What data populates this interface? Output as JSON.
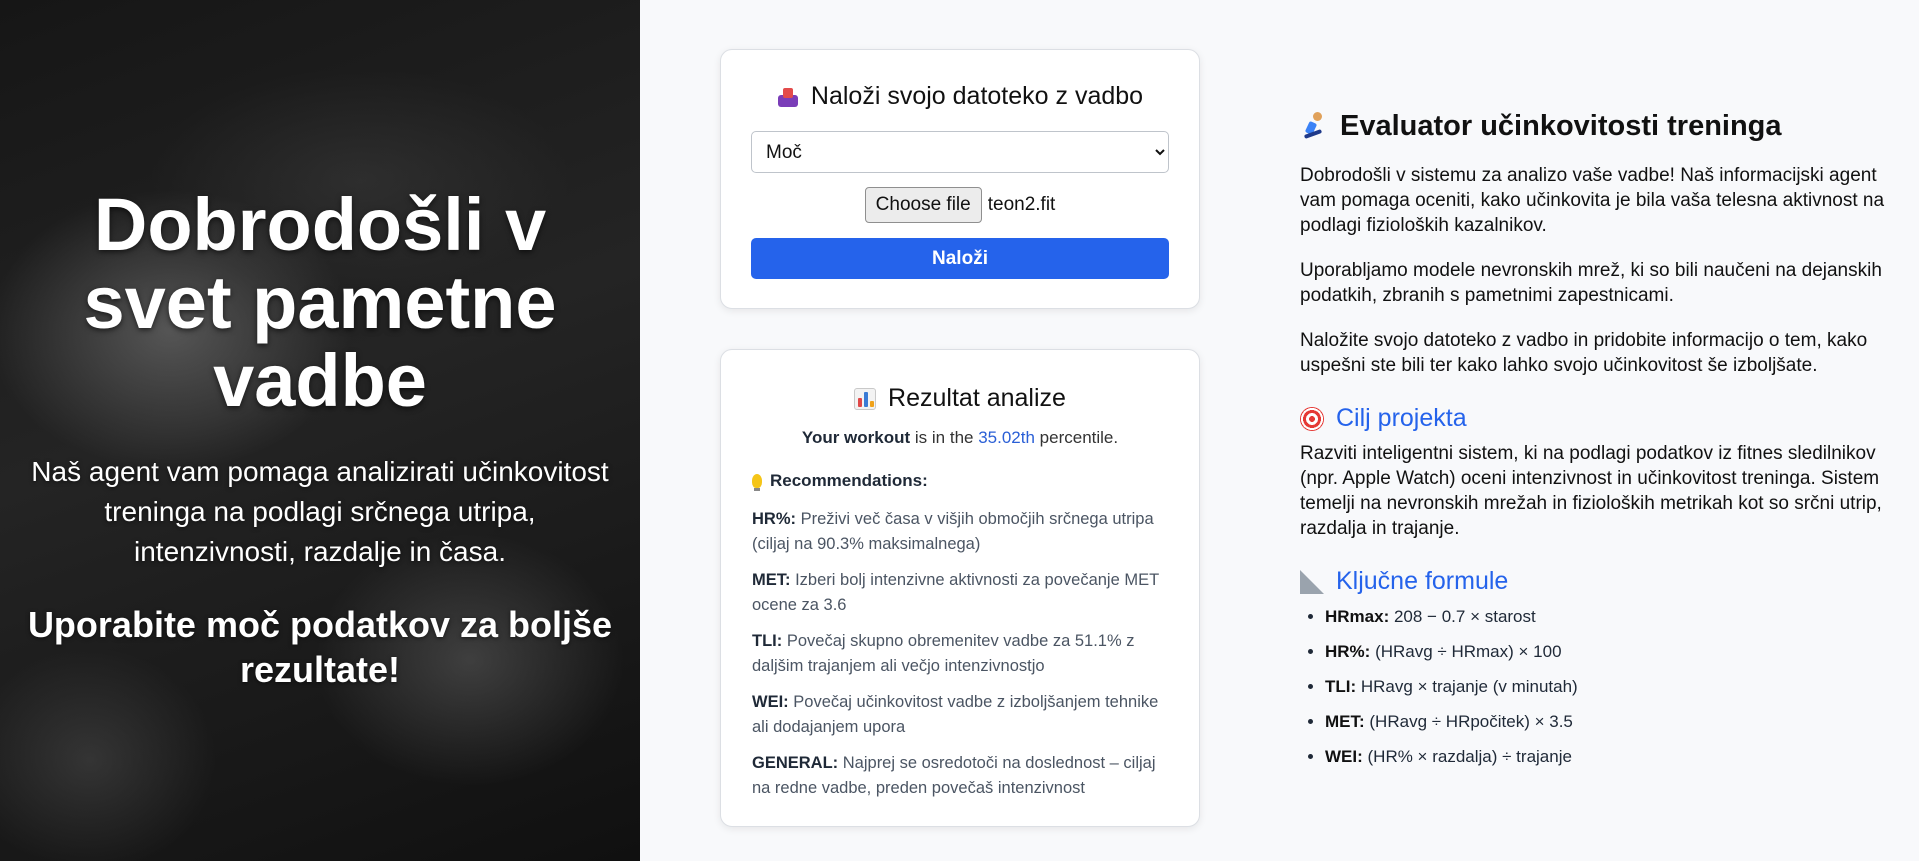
{
  "hero": {
    "title": "Dobrodošli v svet pametne vadbe",
    "lead": "Naš agent vam pomaga analizirati učinkovitost treninga na podlagi srčnega utripa, intenzivnosti, razdalje in časa.",
    "cta": "Uporabite moč podatkov za boljše rezultate!"
  },
  "upload": {
    "icon": "inbox-tray-icon",
    "title": "Naloži svojo datoteko z vadbo",
    "selected_option": "Moč",
    "choose_file_label": "Choose file",
    "file_name": "teon2.fit",
    "submit_label": "Naloži"
  },
  "result": {
    "icon": "bar-chart-icon",
    "title": "Rezultat analize",
    "workout_label": "Your workout",
    "mid_text": " is in the ",
    "percentile_value": "35.02th",
    "percentile_suffix": " percentile.",
    "recommendations_label": "Recommendations:",
    "recommendations": [
      {
        "key": "HR%:",
        "text": " Preživi več časa v višjih območjih srčnega utripa (ciljaj na 90.3% maksimalnega)"
      },
      {
        "key": "MET:",
        "text": " Izberi bolj intenzivne aktivnosti za povečanje MET ocene za 3.6"
      },
      {
        "key": "TLI:",
        "text": " Povečaj skupno obremenitev vadbe za 51.1% z daljšim trajanjem ali večjo intenzivnostjo"
      },
      {
        "key": "WEI:",
        "text": " Povečaj učinkovitost vadbe z izboljšanjem tehnike ali dodajanjem upora"
      },
      {
        "key": "GENERAL:",
        "text": " Najprej se osredotoči na doslednost – ciljaj na redne vadbe, preden povečaš intenzivnost"
      }
    ]
  },
  "info": {
    "title": "Evaluator učinkovitosti treninga",
    "p1": "Dobrodošli v sistemu za analizo vaše vadbe! Naš informacijski agent vam pomaga oceniti, kako učinkovita je bila vaša telesna aktivnost na podlagi fizioloških kazalnikov.",
    "p2": "Uporabljamo modele nevronskih mrež, ki so bili naučeni na dejanskih podatkih, zbranih s pametnimi zapestnicami.",
    "p3": "Naložite svojo datoteko z vadbo in pridobite informacijo o tem, kako uspešni ste bili ter kako lahko svojo učinkovitost še izboljšate.",
    "goal_title": "Cilj projekta",
    "goal_text": "Razviti inteligentni sistem, ki na podlagi podatkov iz fitnes sledilnikov (npr. Apple Watch) oceni intenzivnost in učinkovitost treninga. Sistem temelji na nevronskih mrežah in fizioloških metrikah kot so srčni utrip, razdalja in trajanje.",
    "formulas_title": "Ključne formule",
    "formulas": [
      {
        "key": "HRmax:",
        "text": " 208 − 0.7 × starost"
      },
      {
        "key": "HR%:",
        "text": " (HRavg ÷ HRmax) × 100"
      },
      {
        "key": "TLI:",
        "text": " HRavg × trajanje (v minutah)"
      },
      {
        "key": "MET:",
        "text": " (HRavg ÷ HRpočitek) × 3.5"
      },
      {
        "key": "WEI:",
        "text": " (HR% × razdalja) ÷ trajanje"
      }
    ]
  },
  "colors": {
    "accent": "#2563eb",
    "percentile": "#2a5fd6"
  }
}
